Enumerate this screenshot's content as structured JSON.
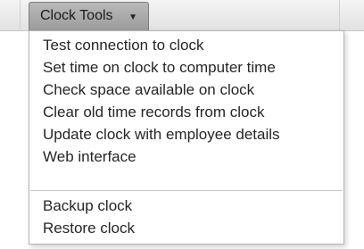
{
  "toolbar": {
    "menu_button_label": "Clock Tools",
    "caret_icon": "chevron-down-icon"
  },
  "menu": {
    "group_1": [
      "Test connection to clock",
      "Set time on clock to computer time",
      "Check space available on clock",
      "Clear old time records from clock",
      "Update clock with employee details",
      "Web interface"
    ],
    "group_2": [
      "Backup clock",
      "Restore clock"
    ]
  }
}
